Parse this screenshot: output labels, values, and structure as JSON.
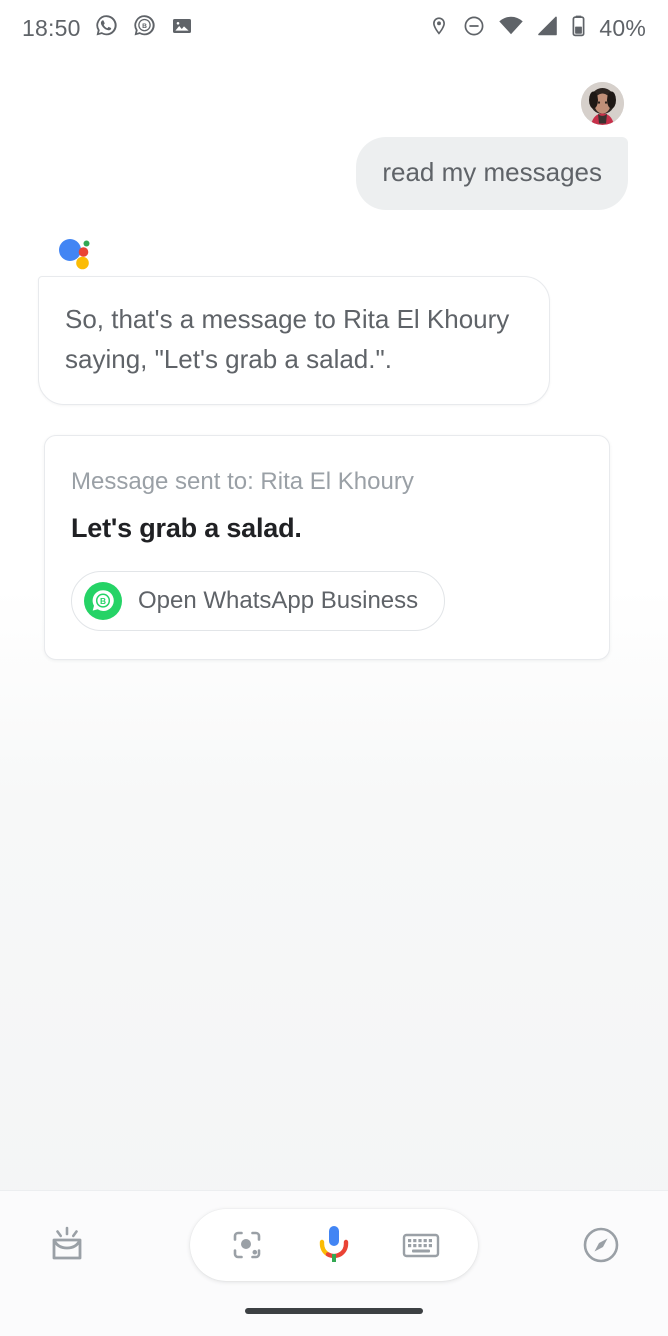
{
  "status_bar": {
    "time": "18:50",
    "battery_percent": "40%",
    "left_icons": [
      "whatsapp-notification-icon",
      "whatsapp-business-notification-icon",
      "photo-notification-icon"
    ],
    "right_icons": [
      "location-icon",
      "do-not-disturb-icon",
      "wifi-icon",
      "cellular-signal-icon",
      "battery-icon"
    ]
  },
  "conversation": {
    "user_message": "read my messages",
    "assistant_logo": "google-assistant-logo",
    "assistant_response": "So, that's a message to Rita El Khoury saying, \"Let's grab a salad.\".",
    "result_card": {
      "subtitle": "Message sent to: Rita El Khoury",
      "message": "Let's grab a salad.",
      "action_label": "Open WhatsApp Business",
      "action_icon": "whatsapp-business-icon"
    }
  },
  "bottom_bar": {
    "snapshot_icon": "snapshot-inbox-icon",
    "lens_icon": "google-lens-icon",
    "mic_icon": "microphone-icon",
    "keyboard_icon": "keyboard-icon",
    "explore_icon": "compass-explore-icon"
  },
  "colors": {
    "google_blue": "#4285F4",
    "google_red": "#EA4335",
    "google_yellow": "#FBBC05",
    "google_green": "#34A853",
    "whatsapp_green": "#25D366",
    "text_primary": "#202124",
    "text_secondary": "#5f6368",
    "text_tertiary": "#9aa0a6",
    "bubble_gray": "#edeff0"
  }
}
